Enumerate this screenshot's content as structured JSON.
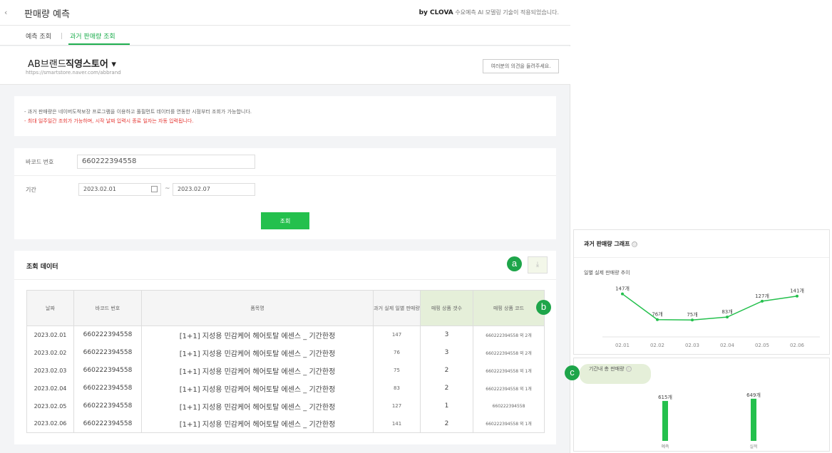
{
  "header": {
    "back_icon": "chevron-left-icon",
    "title": "판매량 예측",
    "clova_brand": "by CLOVA",
    "clova_text": " 수요예측 AI 모델링 기술이 적용되었습니다."
  },
  "tabs": [
    {
      "label": "예측 조회",
      "active": false
    },
    {
      "label": "과거 판매량 조회",
      "active": true
    }
  ],
  "store": {
    "brand": "AB브랜드",
    "name": "직영스토어 ▾",
    "url": "https://smartstore.naver.com/abbrand",
    "opinion_button": "여러분의 의견을 들려주세요."
  },
  "notice": {
    "line1": "- 과거 판매량은 네이버도착보장 프로그램을 이용하고 풀필먼트 데이터를 연동한 시점부터 조회가 가능합니다.",
    "line2": "- 최대 일주일간 조회가 가능하며, 시작 날짜 입력시 종료 일자는 자동 입력됩니다."
  },
  "search": {
    "barcode_label": "바코드 번호",
    "barcode_value": "660222394558",
    "period_label": "기간",
    "start_date": "2023.02.01",
    "tilde": "~",
    "end_date": "2023.02.07",
    "button": "조회"
  },
  "results": {
    "title": "조회 데이터",
    "download_icon": "download-icon",
    "columns": [
      "날짜",
      "바코드 번호",
      "품목명",
      "과거 실제 일별 판매량",
      "매핑 상품 갯수",
      "매핑 상품 코드"
    ],
    "rows": [
      [
        "2023.02.01",
        "660222394558",
        "[1+1] 지성용 민감케어 헤어토탈 에센스 _ 기간한정",
        "147",
        "3",
        "660222394558 외 2개"
      ],
      [
        "2023.02.02",
        "660222394558",
        "[1+1] 지성용 민감케어 헤어토탈 에센스 _ 기간한정",
        "76",
        "3",
        "660222394558 외 2개"
      ],
      [
        "2023.02.03",
        "660222394558",
        "[1+1] 지성용 민감케어 헤어토탈 에센스 _ 기간한정",
        "75",
        "2",
        "660222394558 외 1개"
      ],
      [
        "2023.02.04",
        "660222394558",
        "[1+1] 지성용 민감케어 헤어토탈 에센스 _ 기간한정",
        "83",
        "2",
        "660222394558 외 1개"
      ],
      [
        "2023.02.05",
        "660222394558",
        "[1+1] 지성용 민감케어 헤어토탈 에센스 _ 기간한정",
        "127",
        "1",
        "660222394558"
      ],
      [
        "2023.02.06",
        "660222394558",
        "[1+1] 지성용 민감케어 헤어토탈 에센스 _ 기간한정",
        "141",
        "2",
        "660222394558 외 1개"
      ]
    ]
  },
  "markers": {
    "a": "a",
    "b": "b",
    "c": "c"
  },
  "graph_panel": {
    "title": "과거 판매량 그래프",
    "subtitle": "일별 실제 판매량 추이",
    "info_icon": "ⓘ"
  },
  "total_panel": {
    "title": "기간내 총 판매량",
    "info_icon": "ⓘ"
  },
  "accent_color": "#24c04d",
  "chart_data": [
    {
      "type": "line",
      "title": "일별 실제 판매량 추이",
      "categories": [
        "02.01",
        "02.02",
        "02.03",
        "02.04",
        "02.05",
        "02.06"
      ],
      "values": [
        147,
        76,
        75,
        83,
        127,
        141
      ],
      "labels": [
        "147개",
        "76개",
        "75개",
        "83개",
        "127개",
        "141개"
      ],
      "ylim": [
        40,
        170
      ],
      "grid": false,
      "color": "#24c04d"
    },
    {
      "type": "bar",
      "title": "기간내 총 판매량",
      "categories": [
        "예측",
        "실적"
      ],
      "values": [
        615,
        649
      ],
      "labels": [
        "615개",
        "649개"
      ],
      "ylim": [
        0,
        680
      ],
      "color": "#24c04d"
    }
  ]
}
